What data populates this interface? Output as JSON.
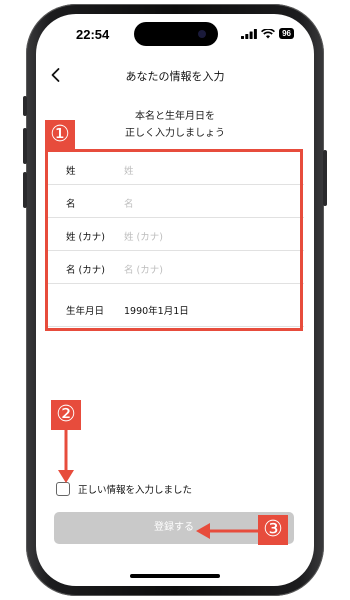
{
  "status_bar": {
    "time": "22:54",
    "battery": "96"
  },
  "nav": {
    "title": "あなたの情報を入力"
  },
  "intro": {
    "line1": "本名と生年月日を",
    "line2": "正しく入力しましょう"
  },
  "form": {
    "rows": [
      {
        "label": "姓",
        "placeholder": "姓",
        "value": ""
      },
      {
        "label": "名",
        "placeholder": "名",
        "value": ""
      },
      {
        "label": "姓 (カナ)",
        "placeholder": "姓 (カナ)",
        "value": ""
      },
      {
        "label": "名 (カナ)",
        "placeholder": "名 (カナ)",
        "value": ""
      },
      {
        "label": "生年月日",
        "placeholder": "",
        "value": "1990年1月1日"
      }
    ]
  },
  "confirm": {
    "checkbox_label": "正しい情報を入力しました",
    "checked": false
  },
  "submit": {
    "label": "登録する",
    "enabled": false
  },
  "annotations": {
    "badge1": "①",
    "badge2": "②",
    "badge3": "③",
    "color": "#e74c3c"
  },
  "icons": {
    "back": "chevron-left-icon",
    "signal": "cellular-signal-icon",
    "wifi": "wifi-icon",
    "battery": "battery-icon"
  }
}
